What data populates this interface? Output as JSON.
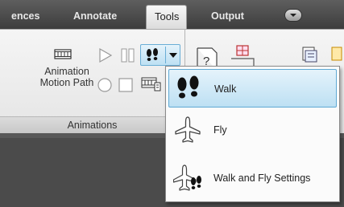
{
  "tabs": [
    {
      "label": "ences",
      "active": false
    },
    {
      "label": "Annotate",
      "active": false
    },
    {
      "label": "Tools",
      "active": true
    },
    {
      "label": "Output",
      "active": false
    }
  ],
  "panel": {
    "animation_label_line1": "Animation",
    "animation_label_line2": "Motion Path",
    "title": "Animations"
  },
  "dropdown": {
    "items": [
      {
        "label": "Walk",
        "icon": "footprints-icon",
        "selected": true
      },
      {
        "label": "Fly",
        "icon": "airplane-icon",
        "selected": false
      },
      {
        "label": "Walk and Fly Settings",
        "icon": "walk-fly-settings-icon",
        "selected": false
      }
    ]
  },
  "colors": {
    "selected_item_bg": "#bde0f3",
    "selected_item_border": "#5fa9d4",
    "ribbon_bg": "#eeeeee",
    "tabbar_bg": "#4a4a4a"
  }
}
